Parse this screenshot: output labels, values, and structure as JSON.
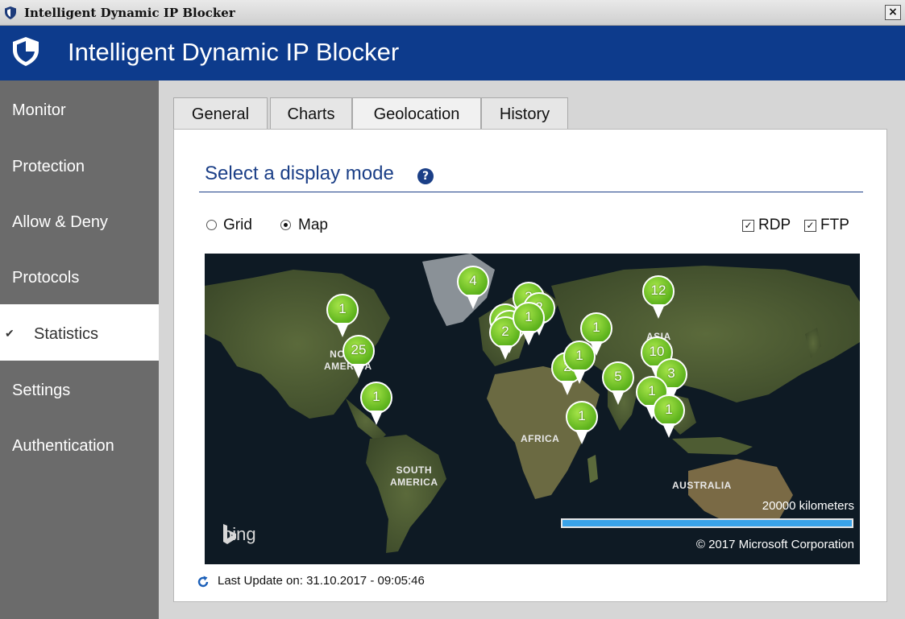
{
  "window": {
    "title": "Intelligent Dynamic IP Blocker",
    "close_label": "×"
  },
  "header": {
    "title": "Intelligent Dynamic IP Blocker",
    "icon": "shield-icon"
  },
  "sidebar": {
    "items": [
      {
        "label": "Monitor"
      },
      {
        "label": "Protection"
      },
      {
        "label": "Allow & Deny"
      },
      {
        "label": "Protocols"
      },
      {
        "label": "Statistics",
        "active": true
      },
      {
        "label": "Settings"
      },
      {
        "label": "Authentication"
      }
    ]
  },
  "tabs": [
    {
      "label": "General"
    },
    {
      "label": "Charts"
    },
    {
      "label": "Geolocation",
      "active": true
    },
    {
      "label": "History"
    }
  ],
  "panel": {
    "title": "Select a display mode",
    "help_icon": "?",
    "mode_options": [
      {
        "label": "Grid",
        "selected": false
      },
      {
        "label": "Map",
        "selected": true
      }
    ],
    "filters": [
      {
        "label": "RDP",
        "checked": true
      },
      {
        "label": "FTP",
        "checked": true
      }
    ]
  },
  "map": {
    "regions": {
      "north_america": "NORTH\nAMERICA",
      "south_america": "SOUTH\nAMERICA",
      "africa": "AFRICA",
      "asia": "ASIA",
      "australia": "AUSTRALIA"
    },
    "markers": [
      "4",
      "1",
      "25",
      "1",
      "2",
      "2",
      "1",
      "1",
      "2",
      "1",
      "1",
      "2",
      "1",
      "1",
      "5",
      "12",
      "10",
      "3",
      "1",
      "1"
    ],
    "scale_label": "20000 kilometers",
    "copyright": "© 2017 Microsoft Corporation",
    "brand": "bing"
  },
  "footer": {
    "last_update": "Last Update on: 31.10.2017 - 09:05:46"
  },
  "colors": {
    "header": "#0d3b8c",
    "sidebar": "#6b6b6b",
    "accent": "#1b3f87",
    "marker": "#6fc422"
  }
}
